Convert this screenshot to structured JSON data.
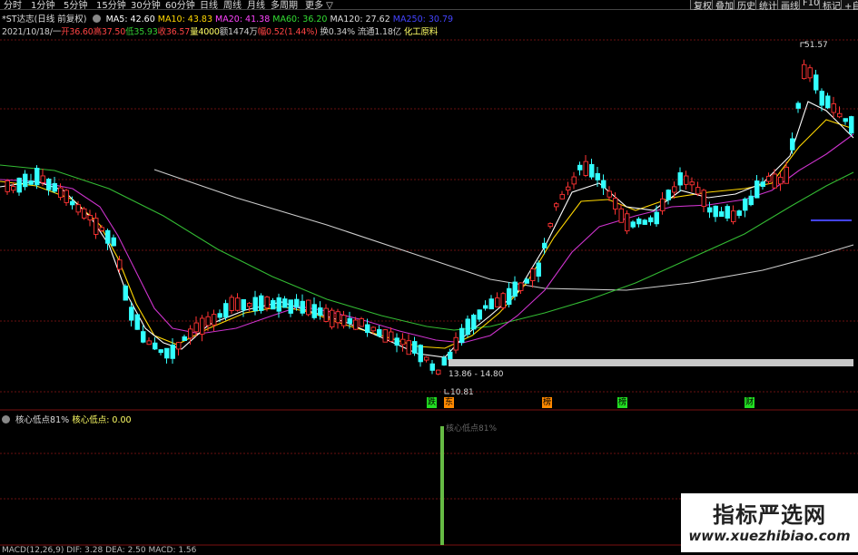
{
  "toolbar": {
    "periods": [
      "分时",
      "1分钟",
      "5分钟",
      "15分钟",
      "30分钟",
      "60分钟",
      "日线",
      "周线",
      "月线",
      "多周期",
      "更多 ▽"
    ],
    "right_buttons": [
      "复权",
      "叠加",
      "历史",
      "统计",
      "画线",
      "F10",
      "标记",
      "+自选"
    ]
  },
  "stock": {
    "name": "*ST达志(日线 前复权)",
    "ma": [
      {
        "text": "MA5: 42.60",
        "color": "#ffffff"
      },
      {
        "text": "MA10: 43.83",
        "color": "#ffd700"
      },
      {
        "text": "MA20: 41.38",
        "color": "#ff44ff"
      },
      {
        "text": "MA60: 36.20",
        "color": "#33dd33"
      },
      {
        "text": "MA120: 27.62",
        "color": "#dddddd"
      },
      {
        "text": "MA250: 30.79",
        "color": "#4444ff"
      }
    ]
  },
  "quote": [
    {
      "text": "2021/10/18/一",
      "color": "#cccccc"
    },
    {
      "text": "开36.60",
      "color": "#ff4444"
    },
    {
      "text": "高37.50",
      "color": "#ff4444"
    },
    {
      "text": "低35.93",
      "color": "#33cc33"
    },
    {
      "text": "收36.57",
      "color": "#ff4444"
    },
    {
      "text": "量4000",
      "color": "#ffff66"
    },
    {
      "text": "额1474万",
      "color": "#cccccc"
    },
    {
      "text": "幅0.52(1.44%)",
      "color": "#ff4444"
    },
    {
      "text": "换0.34%",
      "color": "#cccccc"
    },
    {
      "text": "流通1.18亿",
      "color": "#cccccc"
    },
    {
      "text": "化工原料",
      "color": "#ffff66"
    }
  ],
  "chart": {
    "high_label": "51.57",
    "low_label": "10.81",
    "zone_label": "13.86 - 14.80",
    "events": [
      {
        "label": "跌",
        "color": "#22dd22"
      },
      {
        "label": "东",
        "color": "#ff8800"
      },
      {
        "label": "榜",
        "color": "#ff8800"
      },
      {
        "label": "榜",
        "color": "#22dd22"
      },
      {
        "label": "财",
        "color": "#22dd22"
      }
    ]
  },
  "indicator": {
    "title": "核心低点81%",
    "value": "核心低点: 0.00",
    "bar_label": "核心低点81%"
  },
  "macd": {
    "text": "MACD(12,26,9) DIF: 3.28 DEA: 2.50 MACD: 1.56"
  },
  "watermark": {
    "title": "指标严选网",
    "url": "www.xuezhibiao.com"
  },
  "colors": {
    "up": "#ff3333",
    "down": "#33ffff",
    "ma5": "#ffffff",
    "ma10": "#ffd700",
    "ma20": "#cc33cc",
    "ma60": "#33bb33",
    "ma120": "#cccccc",
    "ma250": "#4444ff",
    "grid": "#6a0f0f"
  }
}
